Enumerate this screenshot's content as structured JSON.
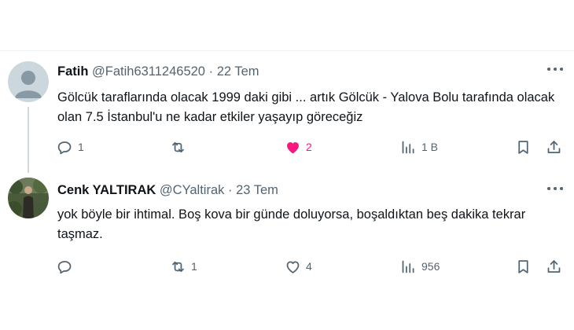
{
  "tweets": [
    {
      "name": "Fatih",
      "handle": "@Fatih6311246520",
      "separator": "·",
      "date": "22 Tem",
      "text": "Gölcük taraflarında olacak 1999 daki gibi ... artık Gölcük - Yalova Bolu tarafında olacak olan 7.5 İstanbul'u ne kadar etkiler yaşayıp göreceğiz",
      "replies": "1",
      "reposts": "",
      "likes": "2",
      "liked": true,
      "views": "1 B"
    },
    {
      "name": "Cenk YALTIRAK",
      "handle": "@CYaltirak",
      "separator": "·",
      "date": "23 Tem",
      "text": "yok böyle bir ihtimal. Boş kova bir günde doluyorsa, boşaldıktan beş dakika tekrar taşmaz.",
      "replies": "",
      "reposts": "1",
      "likes": "4",
      "liked": false,
      "views": "956"
    }
  ],
  "colors": {
    "text": "#0f1419",
    "secondary": "#536471",
    "like_active": "#f91880",
    "divider": "#eff3f4"
  }
}
